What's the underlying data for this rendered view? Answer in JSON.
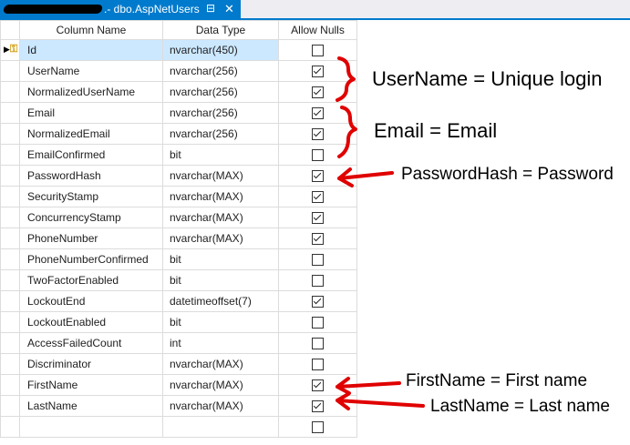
{
  "tab": {
    "title": ".- dbo.AspNetUsers",
    "pin_glyph": "⊟",
    "close_glyph": "✕"
  },
  "grid": {
    "headers": [
      "Column Name",
      "Data Type",
      "Allow Nulls"
    ],
    "rows": [
      {
        "name": "Id",
        "type": "nvarchar(450)",
        "allow_nulls": false,
        "primary_key": true,
        "active": true
      },
      {
        "name": "UserName",
        "type": "nvarchar(256)",
        "allow_nulls": true
      },
      {
        "name": "NormalizedUserName",
        "type": "nvarchar(256)",
        "allow_nulls": true
      },
      {
        "name": "Email",
        "type": "nvarchar(256)",
        "allow_nulls": true
      },
      {
        "name": "NormalizedEmail",
        "type": "nvarchar(256)",
        "allow_nulls": true
      },
      {
        "name": "EmailConfirmed",
        "type": "bit",
        "allow_nulls": false
      },
      {
        "name": "PasswordHash",
        "type": "nvarchar(MAX)",
        "allow_nulls": true
      },
      {
        "name": "SecurityStamp",
        "type": "nvarchar(MAX)",
        "allow_nulls": true
      },
      {
        "name": "ConcurrencyStamp",
        "type": "nvarchar(MAX)",
        "allow_nulls": true
      },
      {
        "name": "PhoneNumber",
        "type": "nvarchar(MAX)",
        "allow_nulls": true
      },
      {
        "name": "PhoneNumberConfirmed",
        "type": "bit",
        "allow_nulls": false
      },
      {
        "name": "TwoFactorEnabled",
        "type": "bit",
        "allow_nulls": false
      },
      {
        "name": "LockoutEnd",
        "type": "datetimeoffset(7)",
        "allow_nulls": true
      },
      {
        "name": "LockoutEnabled",
        "type": "bit",
        "allow_nulls": false
      },
      {
        "name": "AccessFailedCount",
        "type": "int",
        "allow_nulls": false
      },
      {
        "name": "Discriminator",
        "type": "nvarchar(MAX)",
        "allow_nulls": false
      },
      {
        "name": "FirstName",
        "type": "nvarchar(MAX)",
        "allow_nulls": true
      },
      {
        "name": "LastName",
        "type": "nvarchar(MAX)",
        "allow_nulls": true
      },
      {
        "name": "",
        "type": "",
        "allow_nulls": false
      }
    ]
  },
  "annotations": [
    {
      "id": "username",
      "text": "UserName = Unique login"
    },
    {
      "id": "email",
      "text": "Email = Email"
    },
    {
      "id": "passwordhash",
      "text": "PasswordHash = Password"
    },
    {
      "id": "firstname",
      "text": "FirstName = First name"
    },
    {
      "id": "lastname",
      "text": "LastName = Last name"
    }
  ],
  "colors": {
    "accent": "#007acc",
    "selection": "#cce8ff",
    "annotation_ink": "#e00000"
  }
}
